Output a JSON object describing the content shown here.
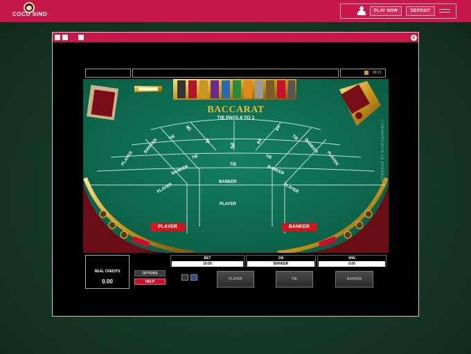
{
  "site": {
    "logo_text": "COCO SINO",
    "colors": {
      "brand": "#c8174a",
      "felt": "#0e6b50"
    },
    "header": {
      "play_now_label": "PLAY NOW",
      "deposit_label": "DEPOSIT",
      "user_icon": "user-icon",
      "menu_icon": "hamburger-menu-icon"
    }
  },
  "game_window": {
    "close_label": "x",
    "status": {
      "time": "09:21"
    },
    "table": {
      "title": "BACCARAT",
      "subtitle": "TIE PAYS 8 TO 1",
      "seat_numbers": [
        "5",
        "4",
        "3",
        "2",
        "1"
      ],
      "tie_label": "TIE",
      "banker_label": "BANKER",
      "player_label": "PLAYER",
      "player_marker": "PLAYER",
      "banker_marker": "BANKER",
      "powered_by": "POWERED BY MICROGAMING™"
    },
    "controls": {
      "credits_label": "REAL CREDITS",
      "credits_value": "0.00",
      "options_label": "OPTIONS",
      "help_label": "HELP",
      "bet_label": "BET",
      "bet_value": "10.00",
      "on_label": "ON",
      "on_value": "BANKER",
      "win_label": "WIN",
      "win_value": "0.00",
      "player_button": "PLAYER",
      "tie_button": "TIE",
      "banker_button": "BANKER"
    }
  }
}
